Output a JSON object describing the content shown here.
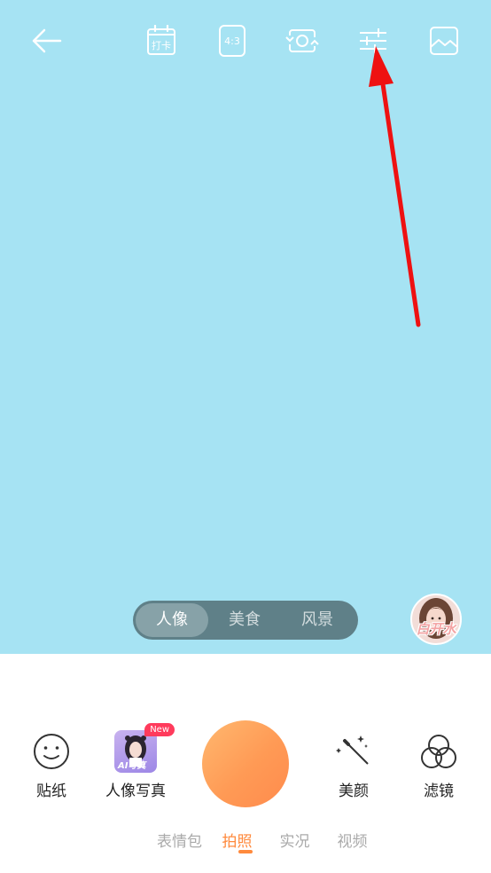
{
  "toolbar": {
    "back_icon": "back-arrow-icon",
    "checkin_label": "打卡",
    "ratio_label": "4:3",
    "flip_icon": "flip-camera-icon",
    "adjust_icon": "adjust-sliders-icon",
    "gallery_icon": "gallery-icon"
  },
  "scene_selector": {
    "items": [
      {
        "label": "人像",
        "active": true
      },
      {
        "label": "美食",
        "active": false
      },
      {
        "label": "风景",
        "active": false
      }
    ]
  },
  "filter_preview": {
    "label": "白开水"
  },
  "tools": {
    "sticker": {
      "label": "贴纸",
      "icon": "smiley-icon"
    },
    "portrait": {
      "label": "人像写真",
      "badge": "New",
      "thumb_caption": "AI写真"
    },
    "beauty": {
      "label": "美颜",
      "icon": "magic-wand-icon"
    },
    "filter": {
      "label": "滤镜",
      "icon": "filter-circles-icon"
    }
  },
  "mode_tabs": [
    {
      "label": "表情包",
      "active": false
    },
    {
      "label": "拍照",
      "active": true
    },
    {
      "label": "实况",
      "active": false
    },
    {
      "label": "视频",
      "active": false
    }
  ],
  "colors": {
    "preview_bg": "#a6e3f3",
    "accent": "#ff8a3d",
    "annotation": "#ee1111"
  }
}
